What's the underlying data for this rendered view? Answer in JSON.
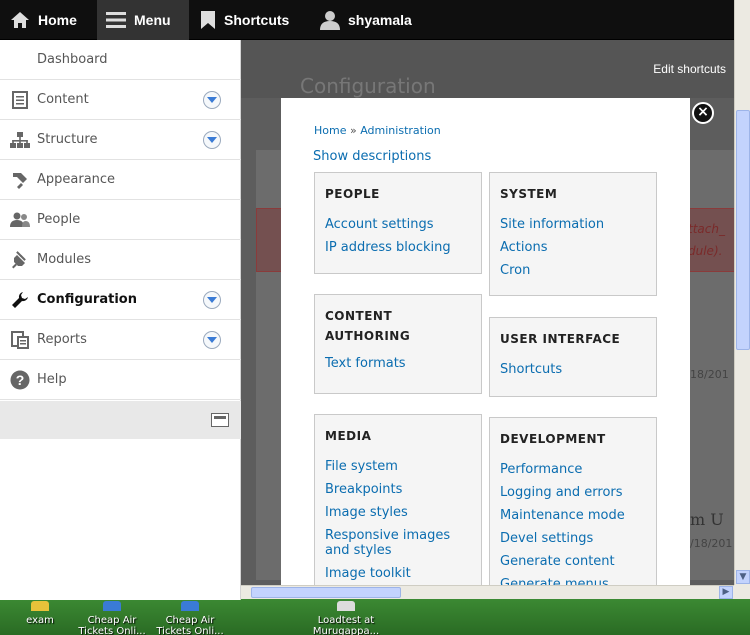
{
  "toolbar": {
    "home_label": "Home",
    "menu_label": "Menu",
    "shortcuts_label": "Shortcuts",
    "user_label": "shyamala"
  },
  "tray": {
    "items": [
      {
        "label": "Dashboard",
        "icon": "none"
      },
      {
        "label": "Content",
        "icon": "document-icon"
      },
      {
        "label": "Structure",
        "icon": "sitemap-icon"
      },
      {
        "label": "Appearance",
        "icon": "paintbrush-icon"
      },
      {
        "label": "People",
        "icon": "people-icon"
      },
      {
        "label": "Modules",
        "icon": "plug-icon"
      },
      {
        "label": "Configuration",
        "icon": "wrench-icon"
      },
      {
        "label": "Reports",
        "icon": "report-icon"
      },
      {
        "label": "Help",
        "icon": "help-icon"
      }
    ]
  },
  "page": {
    "edit_shortcuts": "Edit shortcuts",
    "title": "Configuration",
    "bg_date1": "18/201",
    "bg_date2": "/18/201",
    "bg_um": "m U",
    "bg_err1": "ttach_",
    "bg_err2": "dule)."
  },
  "modal": {
    "breadcrumb_home": "Home",
    "breadcrumb_sep": "»",
    "breadcrumb_admin": "Administration",
    "show_descriptions": "Show descriptions",
    "sections": {
      "people": {
        "title": "PEOPLE",
        "links": [
          "Account settings",
          "IP address blocking"
        ]
      },
      "system": {
        "title": "SYSTEM",
        "links": [
          "Site information",
          "Actions",
          "Cron"
        ]
      },
      "content": {
        "title_line1": "CONTENT",
        "title_line2": "AUTHORING",
        "links": [
          "Text formats"
        ]
      },
      "ui": {
        "title": "USER INTERFACE",
        "links": [
          "Shortcuts"
        ]
      },
      "media": {
        "title": "MEDIA",
        "links": [
          "File system",
          "Breakpoints",
          "Image styles",
          "Responsive images and styles",
          "Image toolkit"
        ]
      },
      "development": {
        "title": "DEVELOPMENT",
        "links": [
          "Performance",
          "Logging and errors",
          "Maintenance mode",
          "Devel settings",
          "Generate content",
          "Generate menus"
        ]
      }
    }
  },
  "desktop": {
    "icons": [
      "exam",
      "Cheap Air Tickets Onli...",
      "Cheap Air Tickets Onli...",
      "Loadtest at Murugappa..."
    ]
  },
  "colors": {
    "toolbar_bg": "#0f0f0f",
    "link": "#0b6db0",
    "overlay": "#5d5d5d"
  }
}
